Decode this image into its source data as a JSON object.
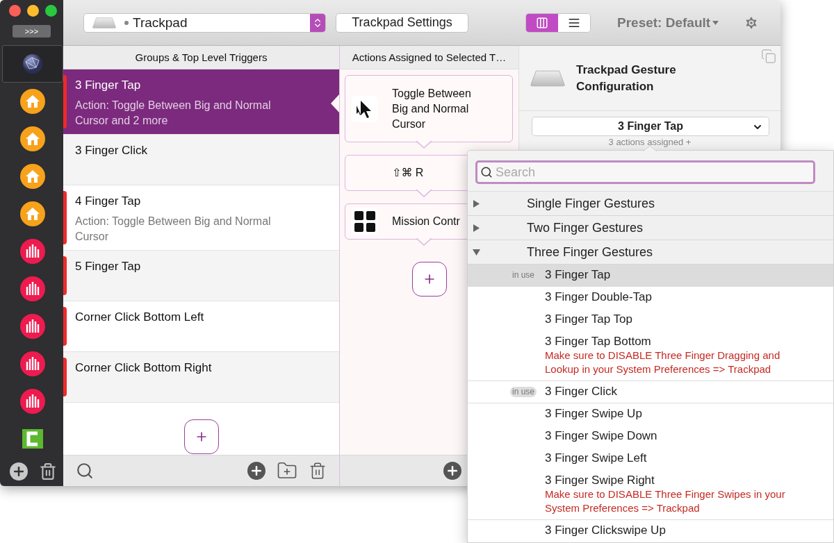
{
  "sidebar": {
    "expand_button": ">>>",
    "apps": [
      {
        "kind": "globe",
        "selected": true
      },
      {
        "kind": "home",
        "selected": false
      },
      {
        "kind": "home",
        "selected": false
      },
      {
        "kind": "home",
        "selected": false
      },
      {
        "kind": "home",
        "selected": false
      },
      {
        "kind": "bars",
        "selected": false
      },
      {
        "kind": "bars",
        "selected": false
      },
      {
        "kind": "bars",
        "selected": false
      },
      {
        "kind": "bars",
        "selected": false
      },
      {
        "kind": "bars",
        "selected": false
      },
      {
        "kind": "letter",
        "selected": false
      }
    ]
  },
  "toolbar": {
    "device": "Trackpad",
    "settings_button": "Trackpad Settings",
    "view_modes": [
      {
        "kind": "columns",
        "selected": true
      },
      {
        "kind": "list",
        "selected": false
      }
    ],
    "preset": "Preset: Default"
  },
  "triggers": {
    "header": "Groups & Top Level Triggers",
    "items": [
      {
        "title": "3 Finger Tap",
        "subtitle": "Action: Toggle Between Big and Normal Cursor and 2 more",
        "enabled": true,
        "selected": true
      },
      {
        "title": "3 Finger Click",
        "enabled": false,
        "selected": false
      },
      {
        "title": "4 Finger Tap",
        "subtitle": "Action: Toggle Between Big and Normal Cursor",
        "enabled": true,
        "selected": false
      },
      {
        "title": "5 Finger Tap",
        "enabled": true,
        "selected": false
      },
      {
        "title": "Corner Click Bottom Left",
        "enabled": true,
        "selected": false
      },
      {
        "title": "Corner Click Bottom Right",
        "enabled": true,
        "selected": false
      }
    ]
  },
  "actions": {
    "header": "Actions Assigned to Selected T…",
    "items": [
      {
        "kind": "cursor",
        "title": "Toggle Between Big and Normal Cursor"
      },
      {
        "kind": "shortcut",
        "title": "⇧⌘ R"
      },
      {
        "kind": "grid",
        "title": "Mission Contr"
      }
    ]
  },
  "config": {
    "title": "Trackpad Gesture Configuration",
    "gesture": "3 Finger Tap",
    "assigned": "3 actions assigned +"
  },
  "popover": {
    "search_placeholder": "Search",
    "groups": [
      {
        "label": "Single Finger Gestures",
        "expanded": false
      },
      {
        "label": "Two Finger Gestures",
        "expanded": false
      },
      {
        "label": "Three Finger Gestures",
        "expanded": true,
        "children": [
          {
            "label": "3 Finger Tap",
            "badge": "in use",
            "selected": true
          },
          {
            "label": "3 Finger Double-Tap",
            "selected": false
          },
          {
            "label": "3 Finger Tap Top",
            "selected": false
          },
          {
            "label": "3 Finger Tap Bottom",
            "warning": "Make sure to DISABLE Three Finger Dragging and Lookup in your System Preferences => Trackpad",
            "selected": false
          },
          {
            "label": "3 Finger Click",
            "badge": "in use",
            "selected": false
          },
          {
            "label": "3 Finger Swipe Up",
            "selected": false
          },
          {
            "label": "3 Finger Swipe Down",
            "selected": false
          },
          {
            "label": "3 Finger Swipe Left",
            "selected": false
          },
          {
            "label": "3 Finger Swipe Right",
            "warning": "Make sure to DISABLE Three Finger Swipes in your System Preferences => Trackpad",
            "selected": false
          },
          {
            "label": "3 Finger Clickswipe Up",
            "selected": false
          }
        ]
      }
    ]
  }
}
